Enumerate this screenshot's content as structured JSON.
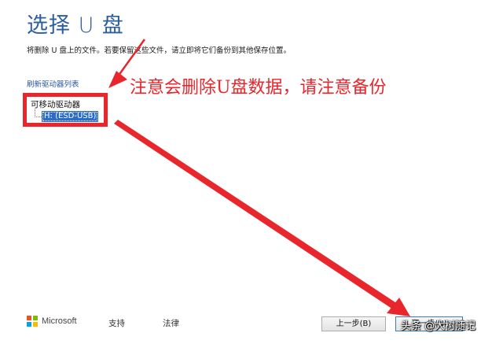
{
  "header": {
    "title": "选择 U 盘",
    "subtitle": "将删除 U 盘上的文件。若要保留这些文件，请立即将它们备份到其他保存位置。"
  },
  "drives": {
    "refresh_label": "刷新驱动器列表",
    "group_label": "可移动驱动器",
    "items": [
      {
        "label": "H: (ESD-USB)",
        "selected": true
      }
    ]
  },
  "annotation": {
    "text": "注意会删除U盘数据，请注意备份",
    "color": "#e8262b"
  },
  "footer": {
    "brand": "Microsoft",
    "support_label": "支持",
    "legal_label": "法律",
    "back_label": "上一步(B)",
    "next_label": "下一步(N)"
  },
  "watermark": {
    "text": "头条 @大树随记"
  },
  "colors": {
    "title": "#2c5e9c",
    "selection": "#2b6dc6",
    "link": "#2b579a",
    "ms_red": "#f25022",
    "ms_green": "#7fba00",
    "ms_blue": "#00a4ef",
    "ms_yellow": "#ffb900"
  }
}
